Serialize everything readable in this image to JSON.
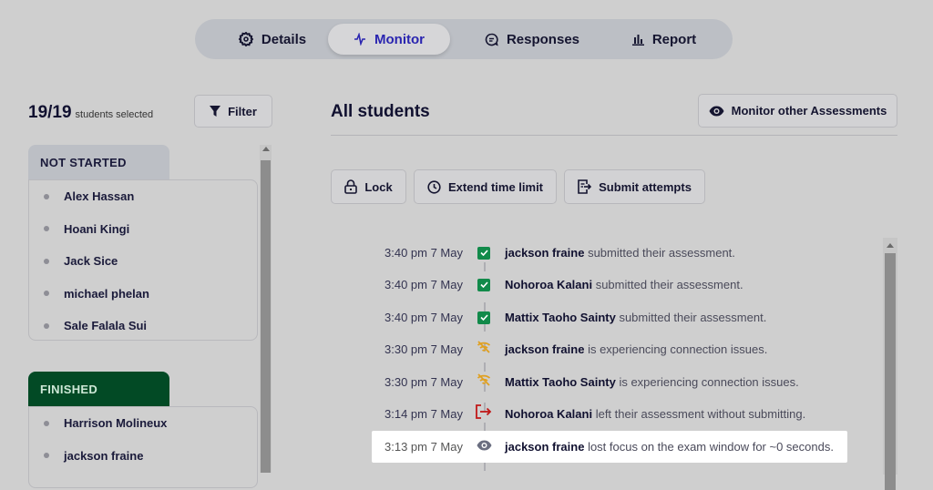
{
  "tabs": [
    {
      "id": "details",
      "label": "Details",
      "icon": "gear-icon",
      "active": false
    },
    {
      "id": "monitor",
      "label": "Monitor",
      "icon": "activity-icon",
      "active": true
    },
    {
      "id": "responses",
      "label": "Responses",
      "icon": "chat-icon",
      "active": false
    },
    {
      "id": "report",
      "label": "Report",
      "icon": "bar-chart-icon",
      "active": false
    }
  ],
  "left": {
    "selected_count": "19/19",
    "selected_label": "students selected",
    "filter_label": "Filter",
    "groups": [
      {
        "title": "NOT STARTED",
        "students": [
          "Alex Hassan",
          "Hoani Kingi",
          "Jack Sice",
          "michael phelan",
          "Sale Falala Sui"
        ]
      },
      {
        "title": "FINISHED",
        "students": [
          "Harrison Molineux",
          "jackson fraine"
        ]
      }
    ]
  },
  "main": {
    "title": "All students",
    "monitor_other_label": "Monitor other Assessments",
    "actions": {
      "lock": "Lock",
      "extend": "Extend time limit",
      "submit": "Submit attempts"
    },
    "events": [
      {
        "time": "3:40 pm 7 May",
        "type": "submitted",
        "name": "jackson fraine",
        "text": "submitted their assessment."
      },
      {
        "time": "3:40 pm 7 May",
        "type": "submitted",
        "name": "Nohoroa Kalani",
        "text": "submitted their assessment."
      },
      {
        "time": "3:40 pm 7 May",
        "type": "submitted",
        "name": "Mattix Taoho Sainty",
        "text": "submitted their assessment."
      },
      {
        "time": "3:30 pm 7 May",
        "type": "connection",
        "name": "jackson fraine",
        "text": "is experiencing connection issues."
      },
      {
        "time": "3:30 pm 7 May",
        "type": "connection",
        "name": "Mattix Taoho Sainty",
        "text": "is experiencing connection issues."
      },
      {
        "time": "3:14 pm 7 May",
        "type": "left",
        "name": "Nohoroa Kalani",
        "text": "left their assessment without submitting."
      },
      {
        "time": "3:13 pm 7 May",
        "type": "focus",
        "name": "jackson fraine",
        "text": "lost focus on the exam window for ~0 seconds.",
        "highlighted": true
      }
    ]
  },
  "colors": {
    "accent": "#2a25b0",
    "finished": "#024a25",
    "success": "#118a4a",
    "warning": "#e0a020",
    "danger": "#c01818"
  }
}
